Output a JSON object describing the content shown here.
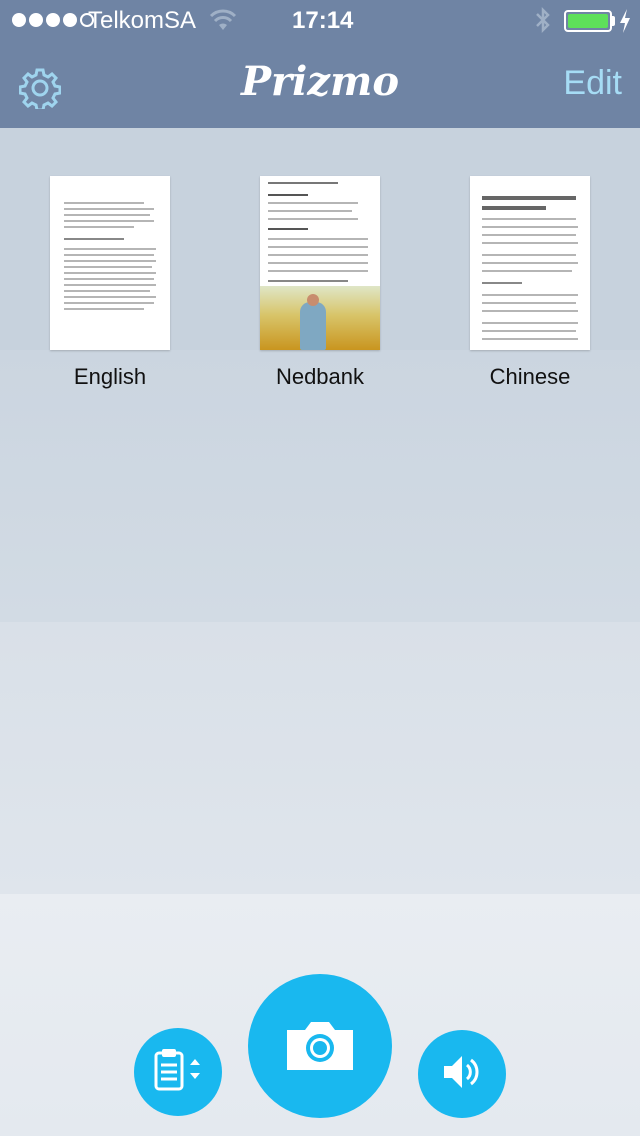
{
  "status_bar": {
    "carrier": "TelkomSA",
    "time": "17:14",
    "signal_bars_filled": 4,
    "signal_bars_total": 5,
    "battery_level": 1.0,
    "battery_color": "#5ee05a"
  },
  "header": {
    "title": "Prizmo",
    "edit_label": "Edit",
    "left_icon": "gear-icon"
  },
  "documents": [
    {
      "label": "English"
    },
    {
      "label": "Nedbank"
    },
    {
      "label": "Chinese"
    }
  ],
  "actions": {
    "clipboard_icon": "clipboard-icon",
    "camera_icon": "camera-icon",
    "speaker_icon": "speaker-icon",
    "accent_color": "#19b8ef"
  },
  "colors": {
    "header_bg": "#6f84a4",
    "edit_text": "#a6dcf5"
  }
}
